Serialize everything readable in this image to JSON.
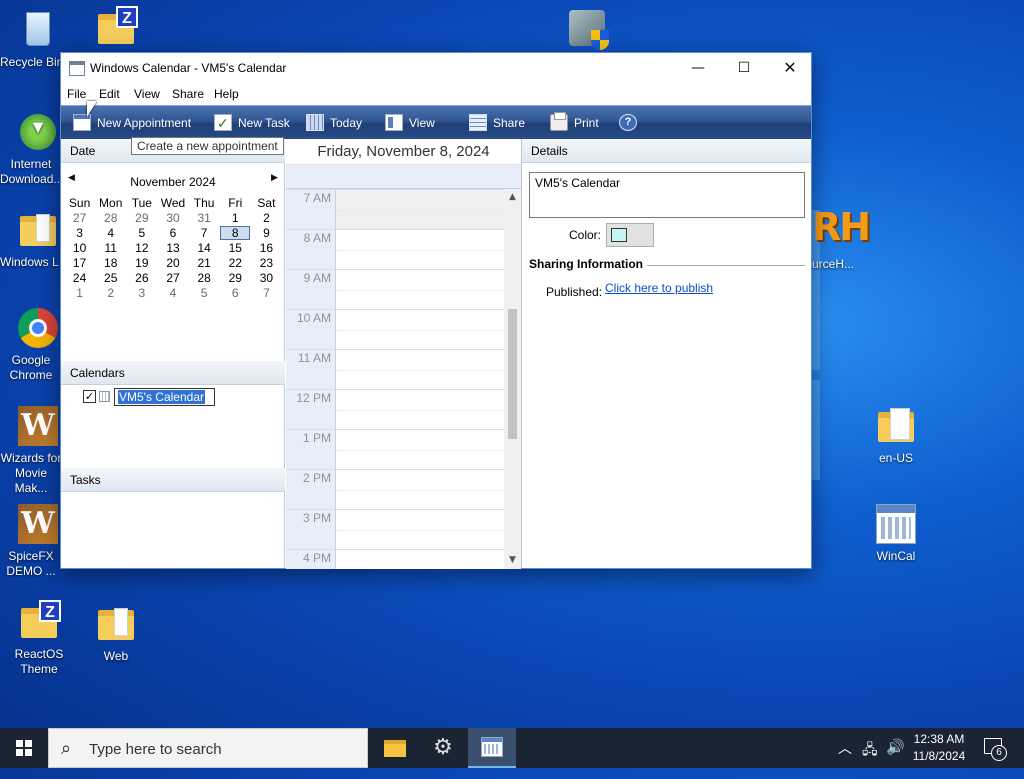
{
  "desktop": {
    "icons": [
      {
        "label": "Recycle Bin",
        "icon": "recycle-bin-icon"
      },
      {
        "label": "Internet Download...",
        "icon": "download-manager-icon"
      },
      {
        "label": "Windows L...",
        "icon": "folder-icon"
      },
      {
        "label": "Google Chrome",
        "icon": "chrome-icon"
      },
      {
        "label": "Wizards for Movie Mak...",
        "icon": "wizards-app-icon"
      },
      {
        "label": "SpiceFX DEMO ...",
        "icon": "spicefx-app-icon"
      },
      {
        "label": "ReactOS Theme",
        "icon": "zip-folder-icon"
      },
      {
        "label": "Web",
        "icon": "folder-icon"
      },
      {
        "label": "en-US",
        "icon": "folder-icon"
      },
      {
        "label": "WinCal",
        "icon": "calendar-app-icon"
      },
      {
        "label": "...urceH...",
        "icon": "resource-hacker-icon"
      }
    ],
    "rh_logo_text": "RH"
  },
  "window": {
    "title": "Windows Calendar - VM5's Calendar",
    "controls": {
      "minimize": "—",
      "maximize": "☐",
      "close": "✕"
    },
    "menu": [
      "File",
      "Edit",
      "View",
      "Share",
      "Help"
    ],
    "toolbar": {
      "new_appointment": "New Appointment",
      "new_task": "New Task",
      "today": "Today",
      "view": "View",
      "share": "Share",
      "print": "Print",
      "help": "?"
    },
    "tooltip": "Create a new appointment"
  },
  "left_pane": {
    "date_header": "Date",
    "month_label": "November 2024",
    "prev_arrow": "◀",
    "next_arrow": "▶",
    "weekdays": [
      "Sun",
      "Mon",
      "Tue",
      "Wed",
      "Thu",
      "Fri",
      "Sat"
    ],
    "weeks": [
      [
        "27",
        "28",
        "29",
        "30",
        "31",
        "1",
        "2"
      ],
      [
        "3",
        "4",
        "5",
        "6",
        "7",
        "8",
        "9"
      ],
      [
        "10",
        "11",
        "12",
        "13",
        "14",
        "15",
        "16"
      ],
      [
        "17",
        "18",
        "19",
        "20",
        "21",
        "22",
        "23"
      ],
      [
        "24",
        "25",
        "26",
        "27",
        "28",
        "29",
        "30"
      ],
      [
        "1",
        "2",
        "3",
        "4",
        "5",
        "6",
        "7"
      ]
    ],
    "selected_day": "8",
    "calendars_header": "Calendars",
    "calendar_name": "VM5's Calendar",
    "calendar_checked": "✓",
    "tasks_header": "Tasks"
  },
  "day_view": {
    "date_title": "Friday, November 8, 2024",
    "hours": [
      "7 AM",
      "8 AM",
      "9 AM",
      "10 AM",
      "11 AM",
      "12 PM",
      "1 PM",
      "2 PM",
      "3 PM",
      "4 PM"
    ],
    "scroll_up": "▲",
    "scroll_down": "▼"
  },
  "details": {
    "header": "Details",
    "calendar_name": "VM5's Calendar",
    "color_label": "Color:",
    "color_value": "#c6f3f5",
    "sharing_header": "Sharing Information",
    "published_label": "Published:",
    "publish_link": "Click here to publish"
  },
  "taskbar": {
    "search_placeholder": "Type here to search",
    "time": "12:38 AM",
    "date": "11/8/2024",
    "notification_count": "6"
  }
}
